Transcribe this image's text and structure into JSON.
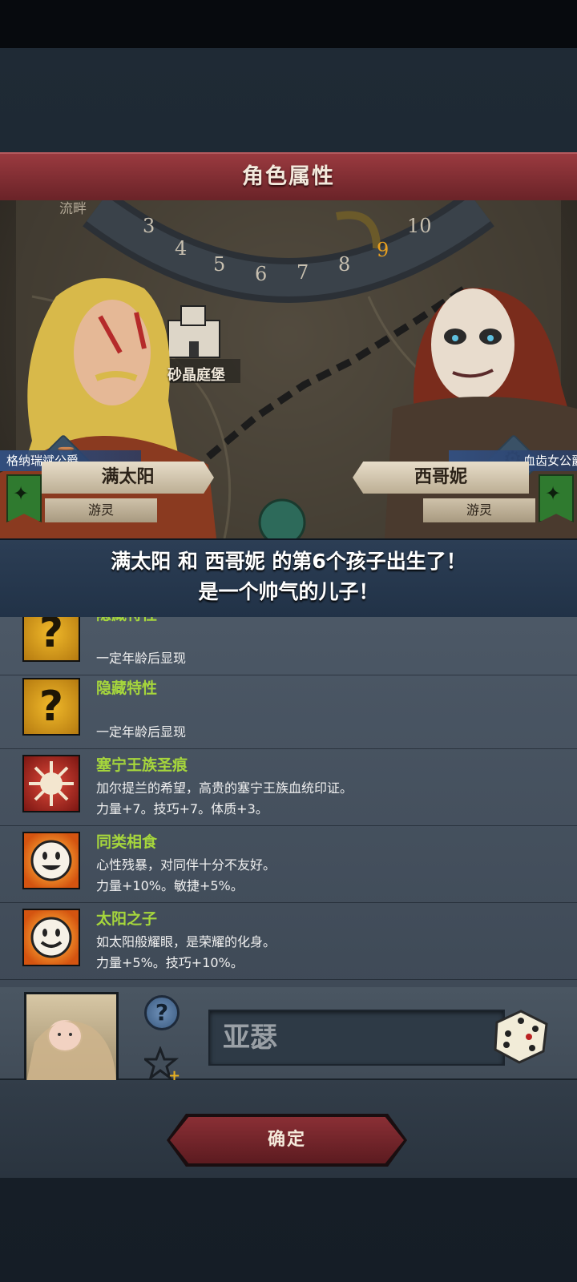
{
  "dialog": {
    "title": "角色属性"
  },
  "map": {
    "corner_label": "流畔",
    "castle_label": "砂晶庭堡",
    "dial_numbers": [
      "3",
      "4",
      "5",
      "6",
      "7",
      "8",
      "9",
      "10"
    ],
    "highlight_number": "9"
  },
  "father": {
    "title": "格纳瑞斌公爵",
    "name": "满太阳",
    "status": "游灵"
  },
  "mother": {
    "title": "血齿女公爵",
    "name": "西哥妮",
    "status": "游灵"
  },
  "announcement": {
    "line1": "满太阳 和 西哥妮 的第6个孩子出生了！",
    "line2": "是一个帅气的儿子！"
  },
  "traits": [
    {
      "name": "隐藏特性",
      "desc": "一定年龄后显现",
      "stats": "",
      "icon": "question-icon"
    },
    {
      "name": "隐藏特性",
      "desc": "一定年龄后显现",
      "stats": "",
      "icon": "question-icon"
    },
    {
      "name": "塞宁王族圣痕",
      "desc": "加尔提兰的希望，高贵的塞宁王族血统印证。",
      "stats": "力量+7。技巧+7。体质+3。",
      "icon": "sun-sigil-icon"
    },
    {
      "name": "同类相食",
      "desc": "心性残暴，对同伴十分不友好。",
      "stats": "力量+10%。敏捷+5%。",
      "icon": "grin-face-icon"
    },
    {
      "name": "太阳之子",
      "desc": "如太阳般耀眼，是荣耀的化身。",
      "stats": "力量+5%。技巧+10%。",
      "icon": "sun-face-icon"
    }
  ],
  "child": {
    "name": "亚瑟",
    "help_symbol": "?"
  },
  "confirm_label": "确定",
  "colors": {
    "header": "#8a2f35",
    "trait_name": "#a6d63c",
    "announcement": "#2c3e55"
  }
}
